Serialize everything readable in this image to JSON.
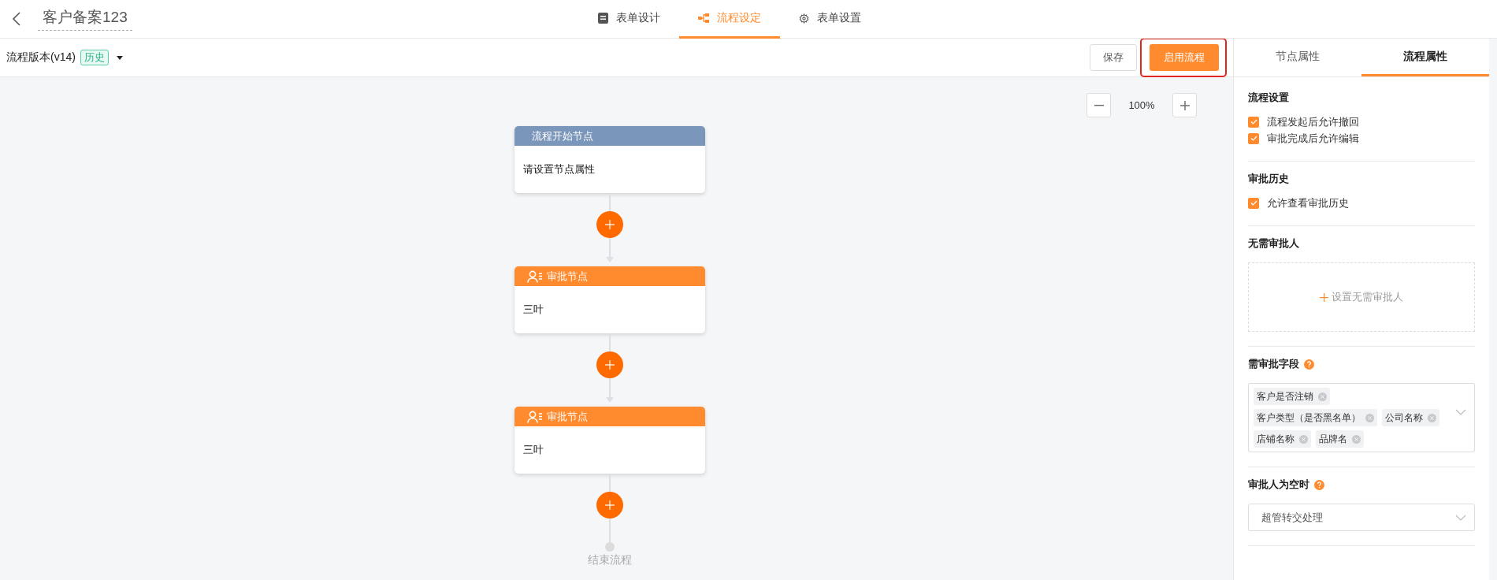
{
  "header": {
    "title": "客户备案123",
    "tabs": [
      {
        "label": "表单设计",
        "selected": false
      },
      {
        "label": "流程设定",
        "selected": true
      },
      {
        "label": "表单设置",
        "selected": false
      }
    ]
  },
  "toolbar": {
    "version_label": "流程版本(v14)",
    "version_badge": "历史",
    "save_button": "保存",
    "enable_button": {
      "label": "启用流程",
      "highlighted": true
    }
  },
  "canvas": {
    "zoom": "100%",
    "nodes": [
      {
        "kind": "start",
        "title": "流程开始节点",
        "body": "请设置节点属性"
      },
      {
        "kind": "approval",
        "title": "审批节点",
        "body": "三叶"
      },
      {
        "kind": "approval",
        "title": "审批节点",
        "body": "三叶"
      }
    ],
    "end_label": "结束流程"
  },
  "panel": {
    "tabs": [
      {
        "label": "节点属性",
        "selected": false
      },
      {
        "label": "流程属性",
        "selected": true
      }
    ],
    "sections": [
      {
        "kind": "checks",
        "title": "流程设置",
        "options": [
          {
            "label": "流程发起后允许撤回",
            "checked": true
          },
          {
            "label": "审批完成后允许编辑",
            "checked": true
          }
        ]
      },
      {
        "kind": "checks",
        "title": "审批历史",
        "options": [
          {
            "label": "允许查看审批历史",
            "checked": true
          }
        ]
      },
      {
        "kind": "add",
        "title": "无需审批人",
        "action": "设置无需审批人"
      },
      {
        "kind": "tags",
        "title": "需审批字段",
        "help": true,
        "tags": [
          "客户是否注销",
          "客户类型（是否黑名单）",
          "公司名称",
          "店铺名称",
          "品牌名"
        ]
      },
      {
        "kind": "select",
        "title": "审批人为空时",
        "help": true,
        "value": "超管转交处理"
      }
    ]
  }
}
